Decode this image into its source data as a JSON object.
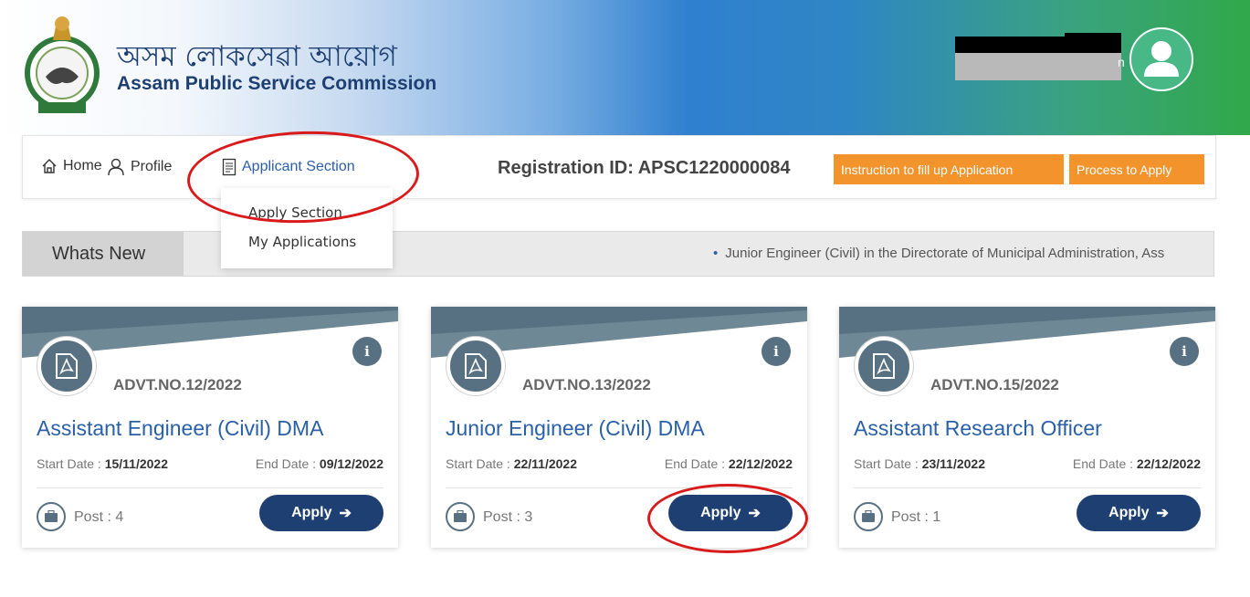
{
  "header": {
    "title_bn": "অসম লোকসেৱা আয়োগ",
    "title_en": "Assam Public Service Commission",
    "user_suffix": "n"
  },
  "nav": {
    "home": "Home",
    "profile": "Profile",
    "applicant_section": "Applicant Section",
    "registration_id": "Registration ID: APSC1220000084",
    "instruction_button": "Instruction to fill up Application",
    "process_button": "Process to Apply"
  },
  "dropdown": {
    "items": [
      "Apply Section",
      "My Applications"
    ]
  },
  "whats_new": {
    "label": "Whats New",
    "ticker": "Junior Engineer (Civil) in the Directorate of Municipal Administration, Ass"
  },
  "cards": [
    {
      "advt": "ADVT.NO.12/2022",
      "title": "Assistant Engineer (Civil) DMA",
      "start_label": "Start Date : ",
      "start_date": "15/11/2022",
      "end_label": "End Date : ",
      "end_date": "09/12/2022",
      "post": "Post : 4",
      "apply": "Apply"
    },
    {
      "advt": "ADVT.NO.13/2022",
      "title": "Junior Engineer (Civil) DMA",
      "start_label": "Start Date : ",
      "start_date": "22/11/2022",
      "end_label": "End Date : ",
      "end_date": "22/12/2022",
      "post": "Post : 3",
      "apply": "Apply"
    },
    {
      "advt": "ADVT.NO.15/2022",
      "title": "Assistant Research Officer",
      "start_label": "Start Date : ",
      "start_date": "23/11/2022",
      "end_label": "End Date : ",
      "end_date": "22/12/2022",
      "post": "Post : 1",
      "apply": "Apply"
    }
  ],
  "colors": {
    "brand_navy": "#1e3f72",
    "link_blue": "#2a60a8",
    "orange": "#f2932b",
    "card_band": "#587182",
    "annotation_red": "#d81a1a"
  }
}
